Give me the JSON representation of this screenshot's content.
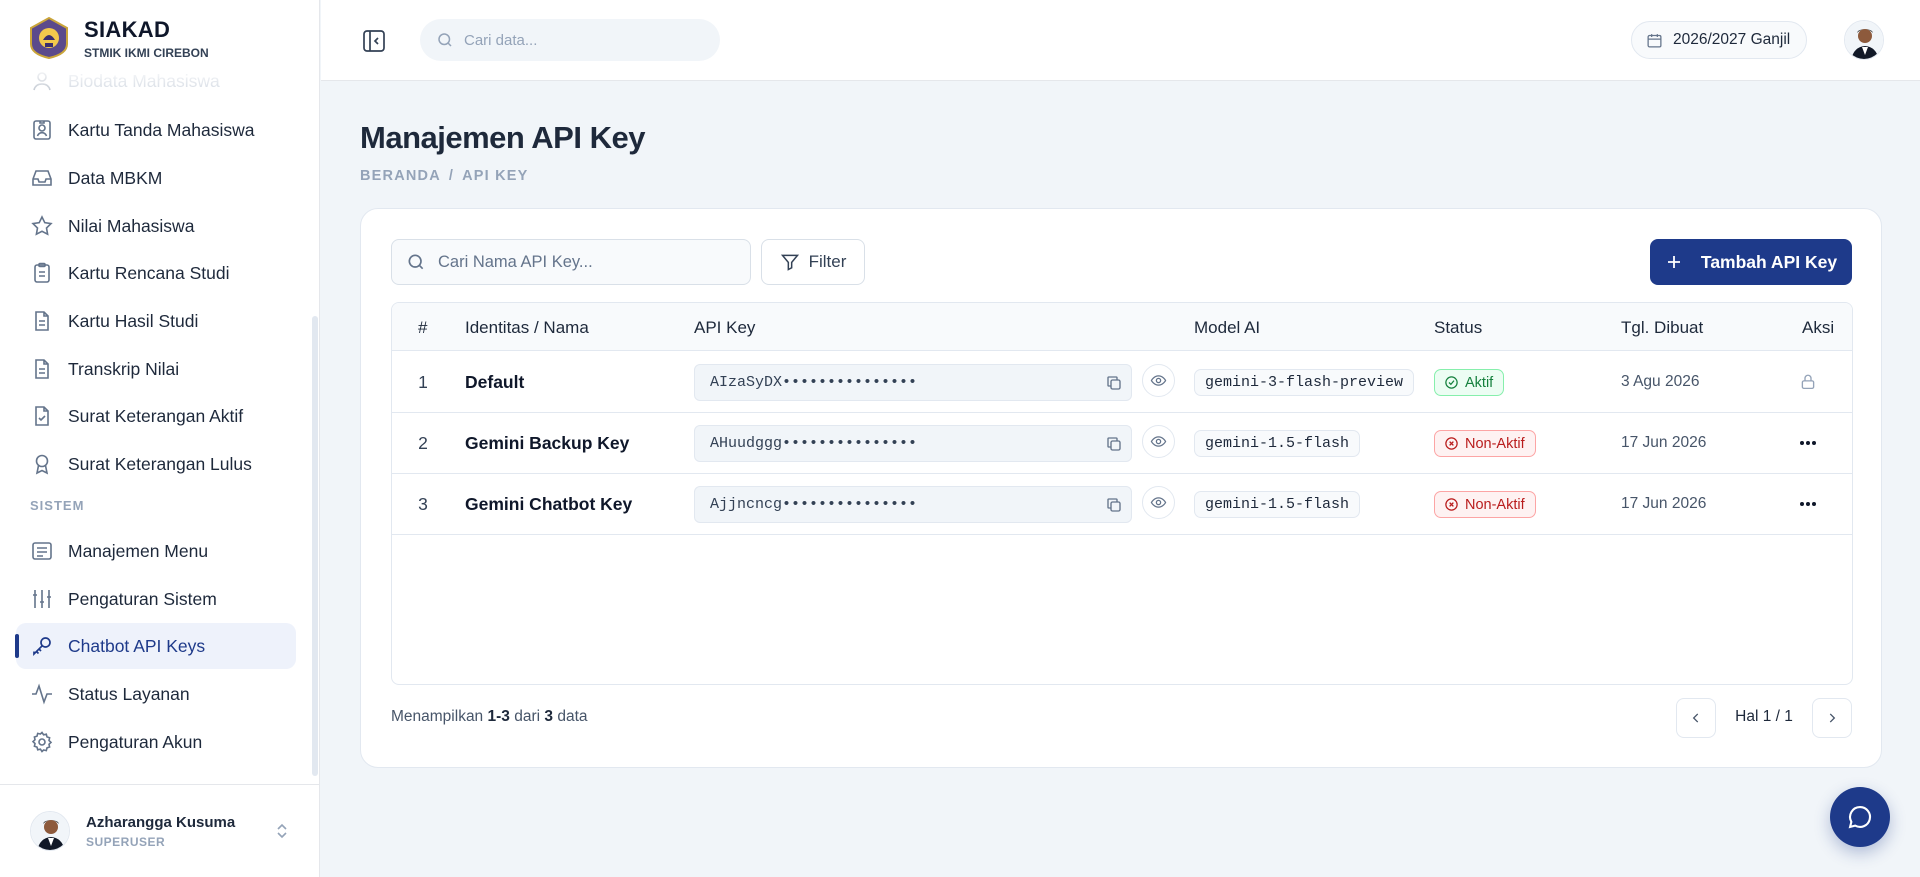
{
  "brand": {
    "title": "SIAKAD",
    "subtitle": "STMIK IKMI CIREBON"
  },
  "sidebar": {
    "items": [
      {
        "label": "Biodata Mahasiswa",
        "icon": "user-icon"
      },
      {
        "label": "Kartu Tanda Mahasiswa",
        "icon": "id-card-icon"
      },
      {
        "label": "Data MBKM",
        "icon": "inbox-icon"
      },
      {
        "label": "Nilai Mahasiswa",
        "icon": "star-icon"
      },
      {
        "label": "Kartu Rencana Studi",
        "icon": "clipboard-icon"
      },
      {
        "label": "Kartu Hasil Studi",
        "icon": "document-icon"
      },
      {
        "label": "Transkrip Nilai",
        "icon": "document-icon"
      },
      {
        "label": "Surat Keterangan Aktif",
        "icon": "file-check-icon"
      },
      {
        "label": "Surat Keterangan Lulus",
        "icon": "award-icon"
      }
    ],
    "section_label": "SISTEM",
    "system_items": [
      {
        "label": "Manajemen Menu",
        "icon": "list-icon"
      },
      {
        "label": "Pengaturan Sistem",
        "icon": "sliders-icon"
      },
      {
        "label": "Chatbot API Keys",
        "icon": "key-icon",
        "active": true
      },
      {
        "label": "Status Layanan",
        "icon": "activity-icon"
      },
      {
        "label": "Pengaturan Akun",
        "icon": "gear-icon"
      }
    ],
    "user": {
      "name": "Azharangga Kusuma",
      "role": "SUPERUSER"
    }
  },
  "header": {
    "search_placeholder": "Cari data...",
    "academic_year": "2026/2027 Ganjil"
  },
  "page": {
    "title": "Manajemen API Key",
    "breadcrumb": [
      "BERANDA",
      "/",
      "API KEY"
    ]
  },
  "toolbar": {
    "search_placeholder": "Cari Nama API Key...",
    "filter_label": "Filter",
    "add_label": "Tambah API Key"
  },
  "table": {
    "columns": [
      "#",
      "Identitas / Nama",
      "API Key",
      "Model AI",
      "Status",
      "Tgl. Dibuat",
      "Aksi"
    ],
    "rows": [
      {
        "no": "1",
        "name": "Default",
        "key": "AIzaSyDX•••••••••••••••",
        "model": "gemini-3-flash-preview",
        "status": "Aktif",
        "status_type": "active",
        "date": "3 Agu 2026",
        "action": "lock-icon"
      },
      {
        "no": "2",
        "name": "Gemini Backup Key",
        "key": "AHuudggg•••••••••••••••",
        "model": "gemini-1.5-flash",
        "status": "Non-Aktif",
        "status_type": "inactive",
        "date": "17 Jun 2026",
        "action": "more-icon"
      },
      {
        "no": "3",
        "name": "Gemini Chatbot Key",
        "key": "Ajjncncg•••••••••••••••",
        "model": "gemini-1.5-flash",
        "status": "Non-Aktif",
        "status_type": "inactive",
        "date": "17 Jun 2026",
        "action": "more-icon"
      }
    ]
  },
  "footer": {
    "prefix": "Menampilkan",
    "range": "1-3",
    "middle": "dari",
    "total": "3",
    "suffix": "data",
    "page_label": "Hal 1 / 1"
  },
  "colors": {
    "primary": "#1e3a8a",
    "active_status": "#15803d",
    "inactive_status": "#b91c1c"
  }
}
